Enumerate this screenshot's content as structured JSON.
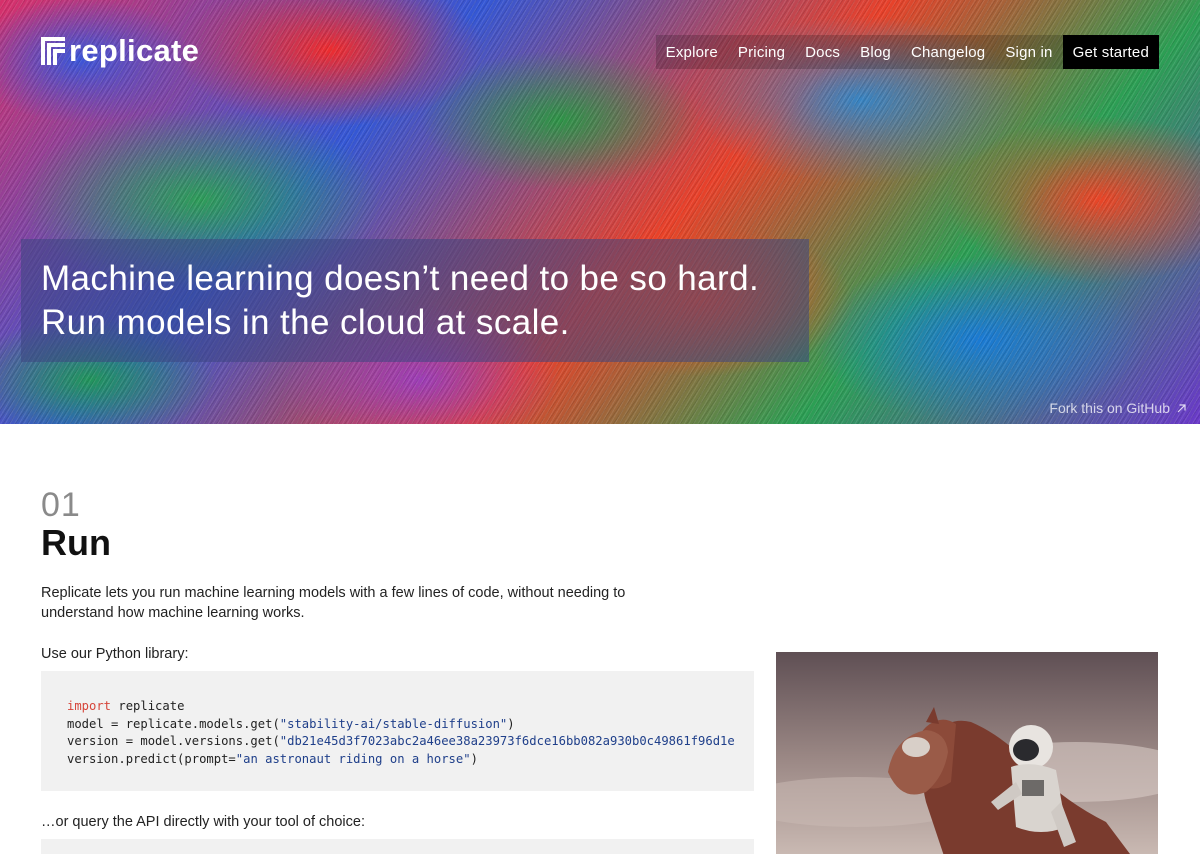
{
  "header": {
    "logo_text": "replicate",
    "nav": [
      "Explore",
      "Pricing",
      "Docs",
      "Blog",
      "Changelog",
      "Sign in"
    ],
    "cta": "Get started"
  },
  "hero": {
    "headline_line1": "Machine learning doesn’t need to be so hard.",
    "headline_line2": "Run models in the cloud at scale.",
    "fork_link": "Fork this on GitHub"
  },
  "section": {
    "number": "01",
    "title": "Run",
    "intro": "Replicate lets you run machine learning models with a few lines of code, without needing to understand how machine learning works.",
    "python_label": "Use our Python library:",
    "code": {
      "kw_import": "import",
      "mod": " replicate",
      "line2_a": "model = replicate.models.get(",
      "line2_str": "\"stability-ai/stable-diffusion\"",
      "line2_b": ")",
      "line3_a": "version = model.versions.get(",
      "line3_str": "\"db21e45d3f7023abc2a46ee38a23973f6dce16bb082a930b0c49861f96d1e",
      "line4_a": "version.predict(prompt=",
      "line4_str": "\"an astronaut riding on a horse\"",
      "line4_b": ")"
    },
    "api_label": "…or query the API directly with your tool of choice:"
  },
  "icons": {
    "logo": "replicate-logo-icon",
    "external_link": "arrow-up-right-icon"
  },
  "colors": {
    "cta_bg": "#000000",
    "code_keyword": "#d6453a",
    "code_string": "#1f3f8a",
    "code_bg": "#f1f1f1"
  }
}
